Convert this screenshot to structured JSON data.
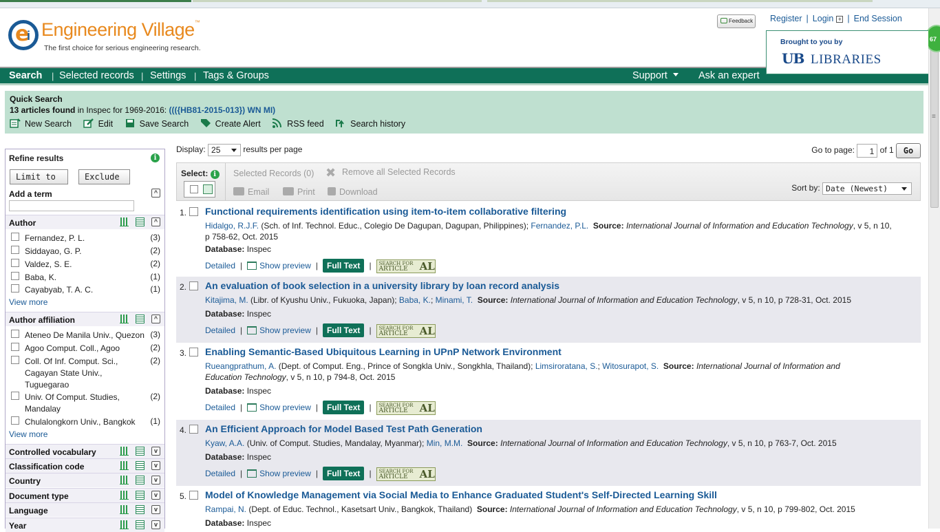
{
  "header": {
    "logo_name": "Engineering Village",
    "logo_tm": "™",
    "tagline": "The first choice for serious engineering research.",
    "feedback_label": "Feedback",
    "register": "Register",
    "login": "Login",
    "end_session": "End Session",
    "brought_by": "Brought to you by",
    "partner_ub": "UB",
    "partner_libraries": "LIBRARIES",
    "badge": "67"
  },
  "nav": {
    "search": "Search",
    "selected_records": "Selected records",
    "settings": "Settings",
    "tags_groups": "Tags & Groups",
    "support": "Support",
    "ask_expert": "Ask an expert"
  },
  "quick_search": {
    "title": "Quick Search",
    "count_text": "13 articles found",
    "in_text": " in Inspec for 1969-2016: ",
    "query": "((({HB81-2015-013}) WN MI)",
    "actions": [
      "New Search",
      "Edit",
      "Save Search",
      "Create Alert",
      "RSS feed",
      "Search history"
    ]
  },
  "refine": {
    "title": "Refine results",
    "limit_to": "Limit to",
    "exclude": "Exclude",
    "add_term": "Add a term",
    "author": {
      "title": "Author",
      "items": [
        {
          "label": "Fernandez, P. L.",
          "count": "(3)"
        },
        {
          "label": "Siddayao, G. P.",
          "count": "(2)"
        },
        {
          "label": "Valdez, S. E.",
          "count": "(2)"
        },
        {
          "label": "Baba, K.",
          "count": "(1)"
        },
        {
          "label": "Cayabyab, T. A. C.",
          "count": "(1)"
        }
      ]
    },
    "affiliation": {
      "title": "Author affiliation",
      "items": [
        {
          "label": "Ateneo De Manila Univ., Quezon",
          "count": "(3)"
        },
        {
          "label": "Agoo Comput. Coll., Agoo",
          "count": "(2)"
        },
        {
          "label": "Coll. Of Inf. Comput. Sci., Cagayan State Univ., Tuguegarao",
          "count": "(2)"
        },
        {
          "label": "Univ. Of Comput. Studies, Mandalay",
          "count": "(2)"
        },
        {
          "label": "Chulalongkorn Univ., Bangkok",
          "count": "(1)"
        }
      ]
    },
    "view_more": "View more",
    "collapsed": [
      "Controlled vocabulary",
      "Classification code",
      "Country",
      "Document type",
      "Language",
      "Year"
    ]
  },
  "results": {
    "display_label": "Display:",
    "per_page": "25",
    "per_page_suffix": "results per page",
    "goto_label": "Go to page:",
    "page": "1",
    "of_text": "of 1",
    "go": "Go",
    "select_label": "Select:",
    "selected_records": "Selected Records (0)",
    "remove_all": "Remove all Selected Records",
    "email": "Email",
    "print": "Print",
    "download": "Download",
    "sort_label": "Sort by:",
    "sort_value": "Date (Newest)",
    "detailed": "Detailed",
    "show_preview": "Show preview",
    "full_text": "Full Text",
    "sfa_top": "SEARCH FOR",
    "sfa_mid": "ARTICLE",
    "sfa_right": "AL",
    "database_label": "Database:",
    "source_label": "Source:",
    "records": [
      {
        "num": "1.",
        "title": "Functional requirements identification using item-to-item collaborative filtering",
        "a1": "Hidalgo, R.J.F.",
        "aff1": " (Sch. of Inf. Technol. Educ., Colegio De Dagupan, Dagupan, Philippines); ",
        "a2": "Fernandez, P.L.",
        "a3": "",
        "a3sep": "",
        "journal": "International Journal of Information and Education Technology",
        "details": ", v 5, n 10, p 758-62, Oct. 2015",
        "database": "Inspec"
      },
      {
        "num": "2.",
        "title": "An evaluation of book selection in a university library by loan record analysis",
        "a1": "Kitajima, M.",
        "aff1": " (Libr. of Kyushu Univ., Fukuoka, Japan); ",
        "a2": "Baba, K.",
        "a3sep": "; ",
        "a3": "Minami, T.",
        "journal": "International Journal of Information and Education Technology",
        "details": ", v 5, n 10, p 728-31, Oct. 2015",
        "database": "Inspec"
      },
      {
        "num": "3.",
        "title": "Enabling Semantic-Based Ubiquitous Learning in UPnP Network Environment",
        "a1": "Rueangprathum, A.",
        "aff1": " (Dept. of Comput. Eng., Prince of Songkla Univ., Songkhla, Thailand); ",
        "a2": "Limsiroratana, S.",
        "a3sep": "; ",
        "a3": "Witosurapot, S.",
        "journal": "International Journal of Information and Education Technology",
        "details": ", v 5, n 10, p 794-8, Oct. 2015",
        "database": "Inspec"
      },
      {
        "num": "4.",
        "title": "An Efficient Approach for Model Based Test Path Generation",
        "a1": "Kyaw, A.A.",
        "aff1": " (Univ. of Comput. Studies, Mandalay, Myanmar); ",
        "a2": "Min, M.M.",
        "a3sep": "",
        "a3": "",
        "journal": "International Journal of Information and Education Technology",
        "details": ", v 5, n 10, p 763-7, Oct. 2015",
        "database": "Inspec"
      },
      {
        "num": "5.",
        "title": "Model of Knowledge Management via Social Media to Enhance Graduated Student's Self-Directed Learning Skill",
        "a1": "Rampai, N.",
        "aff1": " (Dept. of Educ. Technol., Kasetsart Univ., Bangkok, Thailand) ",
        "a2": "",
        "a3sep": "",
        "a3": "",
        "journal": "International Journal of Information and Education Technology",
        "details": ", v 5, n 10, p 799-802, Oct. 2015",
        "database": "Inspec"
      }
    ]
  }
}
